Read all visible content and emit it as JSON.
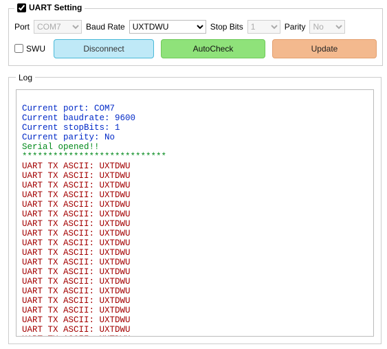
{
  "uart": {
    "group_title_prefix": "UART Setting",
    "checked": true,
    "port_label": "Port",
    "port_value": "COM7",
    "baud_label": "Baud Rate",
    "baud_value": "UXTDWU",
    "stop_label": "Stop Bits",
    "stop_value": "1",
    "parity_label": "Parity",
    "parity_value": "No",
    "swu_label": "SWU",
    "swu_checked": false,
    "btn_disconnect": "Disconnect",
    "btn_autocheck": "AutoCheck",
    "btn_update": "Update"
  },
  "log_title": "Log",
  "log_lines": [
    {
      "c": "",
      "t": " "
    },
    {
      "c": "l-blue",
      "t": "Current port: COM7"
    },
    {
      "c": "l-blue",
      "t": "Current baudrate: 9600"
    },
    {
      "c": "l-blue",
      "t": "Current stopBits: 1"
    },
    {
      "c": "l-blue",
      "t": "Current parity: No"
    },
    {
      "c": "l-green",
      "t": "Serial opened!!"
    },
    {
      "c": "l-green",
      "t": "****************************"
    },
    {
      "c": "l-red",
      "t": "UART TX ASCII: UXTDWU"
    },
    {
      "c": "l-red",
      "t": "UART TX ASCII: UXTDWU"
    },
    {
      "c": "l-red",
      "t": "UART TX ASCII: UXTDWU"
    },
    {
      "c": "l-red",
      "t": "UART TX ASCII: UXTDWU"
    },
    {
      "c": "l-red",
      "t": "UART TX ASCII: UXTDWU"
    },
    {
      "c": "l-red",
      "t": "UART TX ASCII: UXTDWU"
    },
    {
      "c": "l-red",
      "t": "UART TX ASCII: UXTDWU"
    },
    {
      "c": "l-red",
      "t": "UART TX ASCII: UXTDWU"
    },
    {
      "c": "l-red",
      "t": "UART TX ASCII: UXTDWU"
    },
    {
      "c": "l-red",
      "t": "UART TX ASCII: UXTDWU"
    },
    {
      "c": "l-red",
      "t": "UART TX ASCII: UXTDWU"
    },
    {
      "c": "l-red",
      "t": "UART TX ASCII: UXTDWU"
    },
    {
      "c": "l-red",
      "t": "UART TX ASCII: UXTDWU"
    },
    {
      "c": "l-red",
      "t": "UART TX ASCII: UXTDWU"
    },
    {
      "c": "l-red",
      "t": "UART TX ASCII: UXTDWU"
    },
    {
      "c": "l-red",
      "t": "UART TX ASCII: UXTDWU"
    },
    {
      "c": "l-red",
      "t": "UART TX ASCII: UXTDWU"
    },
    {
      "c": "l-red",
      "t": "UART TX ASCII: UXTDWU"
    },
    {
      "c": "l-red",
      "t": "UART TX ASCII: UXTDWU"
    }
  ]
}
